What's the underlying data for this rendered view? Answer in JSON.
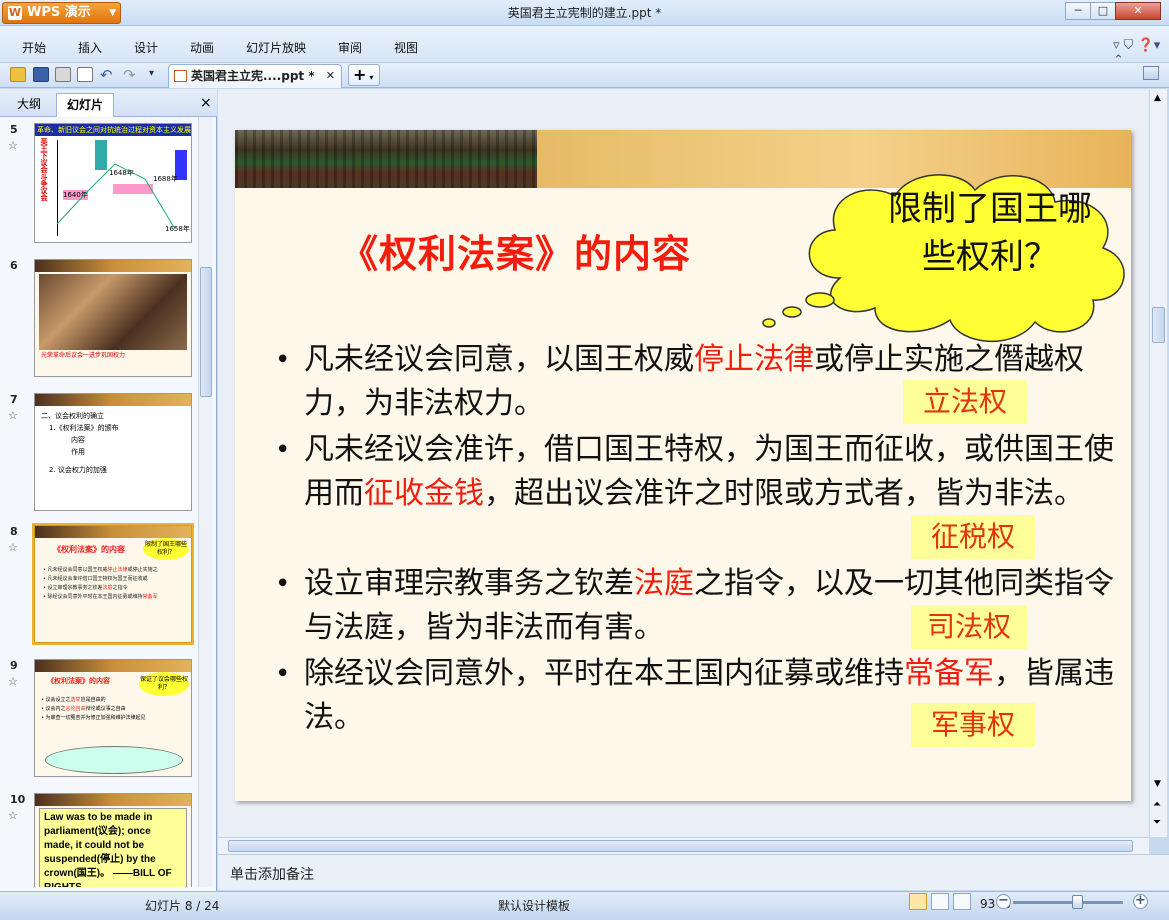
{
  "app": {
    "name": "WPS 演示",
    "logo_glyph": "W"
  },
  "window": {
    "title": "英国君主立宪制的建立.ppt *",
    "minimize": "─",
    "maximize": "□",
    "close": "✕"
  },
  "menu": {
    "items": [
      "开始",
      "插入",
      "设计",
      "动画",
      "幻灯片放映",
      "审阅",
      "视图"
    ]
  },
  "toolbar": {
    "doc_tab": "英国君主立宪....ppt *",
    "new_tab": "+"
  },
  "left_panel": {
    "tabs": [
      "大纲",
      "幻灯片"
    ],
    "close": "×",
    "thumbnails": [
      {
        "num": "5",
        "title": "革命、新旧议会之间对抗统治过程对资本主义发展",
        "notes": [
          "1648年",
          "1688年",
          "1640年",
          "1658年"
        ]
      },
      {
        "num": "6",
        "caption": "光荣革命后议会一进步巩固权力"
      },
      {
        "num": "7",
        "lines": [
          "二、议会权利的确立",
          "1.《权利法案》的颁布",
          "内容",
          "作用",
          "2. 议会权力的加强"
        ]
      },
      {
        "num": "8",
        "title": "《权利法案》的内容",
        "cloud": "限制了国王哪些权利？"
      },
      {
        "num": "9",
        "title": "《权利法案》的内容",
        "cloud": "保证了议会哪些权利？"
      },
      {
        "num": "10",
        "text": "Law was to be made in parliament(议会); once made, it could not be suspended(停止) by the crown(国王)。 ——BILL OF RIGHTS"
      }
    ]
  },
  "slide": {
    "title": "《权利法案》的内容",
    "cloud_text": "限制了国王哪些权利？",
    "bullets": [
      {
        "before": "凡未经议会同意，以国王权威",
        "red": "停止法律",
        "after": "或停止实施之僭越权力，为非法权力。",
        "tag": "立法权"
      },
      {
        "before": "凡未经议会准许，借口国王特权，为国王而征收，或供国王使用而",
        "red": "征收金钱",
        "after": "，超出议会准许之时限或方式者，皆为非法。",
        "tag": "征税权"
      },
      {
        "before": "设立审理宗教事务之钦差",
        "red": "法庭",
        "after": "之指令，以及一切其他同类指令与法庭，皆为非法而有害。",
        "tag": "司法权"
      },
      {
        "before": "除经议会同意外，平时在本王国内征募或维持",
        "red": "常备军",
        "after": "，皆属违法。",
        "tag": "军事权"
      }
    ]
  },
  "notes": {
    "placeholder": "单击添加备注"
  },
  "status": {
    "slide_counter": "幻灯片 8 / 24",
    "template": "默认设计模板",
    "zoom": "93 %",
    "zoom_level": 0.93
  },
  "colors": {
    "title_red": "#f21d0d",
    "tag_bg": "#ffff99",
    "cloud_yellow": "#ffff33",
    "wps_orange": "#e0740d"
  }
}
